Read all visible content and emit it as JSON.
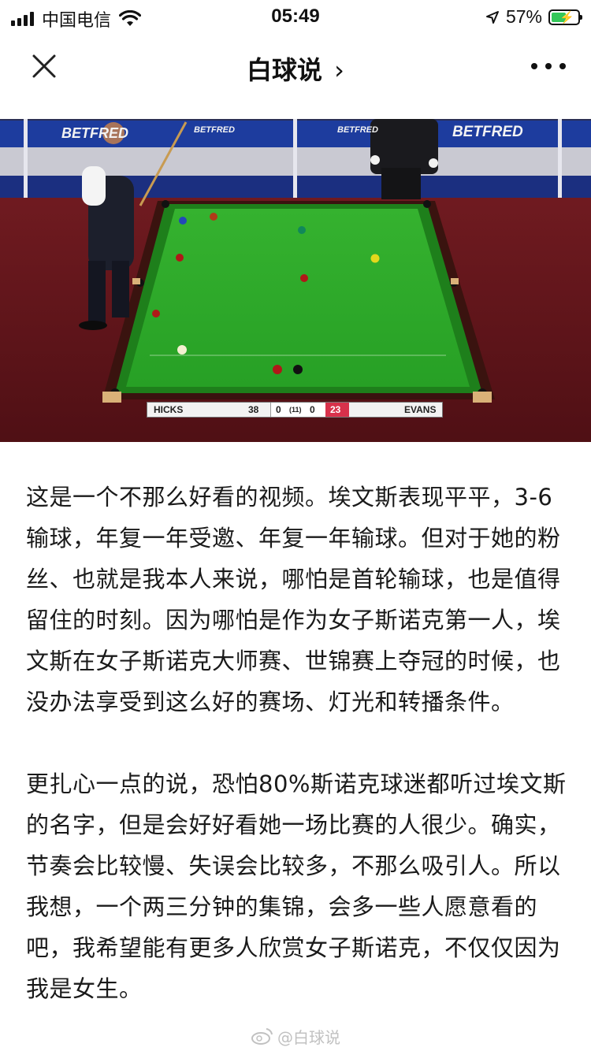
{
  "status_bar": {
    "carrier": "中国电信",
    "time": "05:49",
    "battery_percent_label": "57%",
    "battery_level": 0.57,
    "icons": [
      "signal-icon",
      "wifi-icon",
      "location-arrow-icon",
      "battery-icon"
    ]
  },
  "nav": {
    "title": "白球说",
    "title_chevron": "›",
    "close_icon": "close-icon",
    "more_icon": "more-icon"
  },
  "video": {
    "banner_text": "BETFRED",
    "scoreboard": {
      "player1": "HICKS",
      "score1": "38",
      "frames1": "0",
      "best_of": "(11)",
      "frames2": "0",
      "score2": "23",
      "player2": "EVANS"
    },
    "colors": {
      "cloth": "#2ea82a",
      "arena_floor": "#6a1a20",
      "banner": "#1d3c9e",
      "score_highlight": "#d8314b"
    }
  },
  "article": {
    "paragraphs": [
      "这是一个不那么好看的视频。埃文斯表现平平，3-6输球，年复一年受邀、年复一年输球。但对于她的粉丝、也就是我本人来说，哪怕是首轮输球，也是值得留住的时刻。因为哪怕是作为女子斯诺克第一人，埃文斯在女子斯诺克大师赛、世锦赛上夺冠的时候，也没办法享受到这么好的赛场、灯光和转播条件。",
      "更扎心一点的说，恐怕80%斯诺克球迷都听过埃文斯的名字，但是会好好看她一场比赛的人很少。确实，节奏会比较慢、失误会比较多，不那么吸引人。所以我想，一个两三分钟的集锦，会多一些人愿意看的吧，我希望能有更多人欣赏女子斯诺克，不仅仅因为我是女生。"
    ]
  },
  "watermark": "@白球说"
}
